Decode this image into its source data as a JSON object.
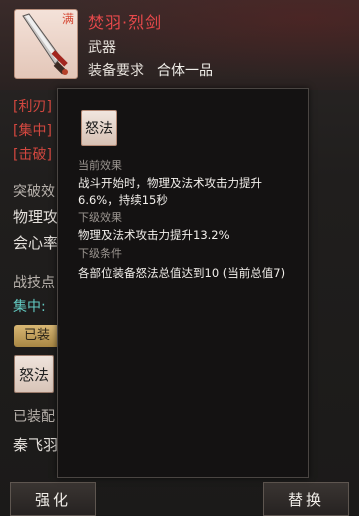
{
  "item": {
    "full_mark": "满",
    "name": "焚羽·烈剑",
    "type": "武器",
    "equip_requirement_label": "装备要求",
    "equip_requirement_value": "合体一品"
  },
  "left_panel": {
    "attr_lines": [
      "[利刃]",
      "[集中]",
      "[击破]"
    ],
    "breakthrough_label": "突破效",
    "breakthrough_line1": "物理攻",
    "breakthrough_line2": "会心率",
    "skill_point_label": "战技点",
    "focus_label": "集中:",
    "equipped_badge": "已装",
    "skill_icon_text": "怒法",
    "equipped_label": "已装配",
    "character_name": "秦飞羽"
  },
  "tooltip": {
    "icon_text": "怒法",
    "current_effect_label": "当前效果",
    "current_effect_text": "战斗开始时，物理及法术攻击力提升6.6%，持续15秒",
    "next_effect_label": "下级效果",
    "next_effect_text": "物理及法术攻击力提升13.2%",
    "next_condition_label": "下级条件",
    "next_condition_text": "各部位装备怒法总值达到10 (当前总值7)"
  },
  "buttons": {
    "enhance": "强化",
    "replace": "替换"
  },
  "colors": {
    "name_red": "#e7494b",
    "tag_red": "#d2473f",
    "cyan": "#62c8c0",
    "gold_badge": "#d8b774"
  }
}
